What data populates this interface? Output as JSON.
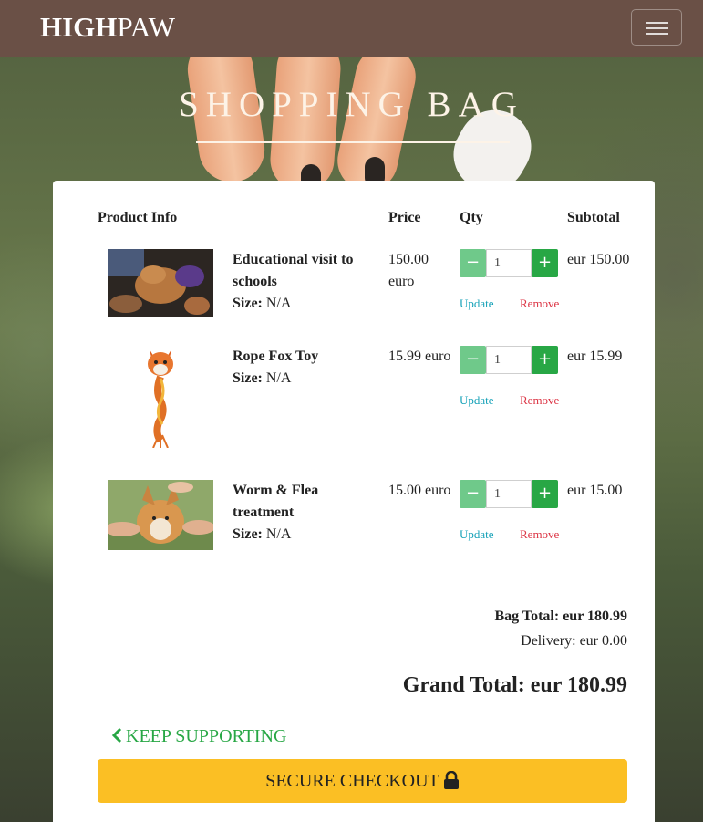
{
  "navbar": {
    "brand_bold": "HIGH",
    "brand_rest": "PAW"
  },
  "page": {
    "title": "SHOPPING BAG"
  },
  "table": {
    "headers": {
      "product": "Product Info",
      "price": "Price",
      "qty": "Qty",
      "subtotal": "Subtotal"
    },
    "items": [
      {
        "name": "Educational visit to schools",
        "size_label": "Size:",
        "size": "N/A",
        "price": "150.00 euro",
        "qty": "1",
        "subtotal": "eur 150.00",
        "update": "Update",
        "remove": "Remove"
      },
      {
        "name": "Rope Fox Toy",
        "size_label": "Size:",
        "size": "N/A",
        "price": "15.99 euro",
        "qty": "1",
        "subtotal": "eur 15.99",
        "update": "Update",
        "remove": "Remove"
      },
      {
        "name": "Worm & Flea treatment",
        "size_label": "Size:",
        "size": "N/A",
        "price": "15.00 euro",
        "qty": "1",
        "subtotal": "eur 15.00",
        "update": "Update",
        "remove": "Remove"
      }
    ]
  },
  "summary": {
    "bag_total": "Bag Total: eur 180.99",
    "delivery": "Delivery: eur 0.00",
    "grand_total": "Grand Total: eur 180.99"
  },
  "actions": {
    "keep_supporting": "KEEP SUPPORTING",
    "checkout": "SECURE CHECKOUT"
  },
  "icons": {
    "menu": "hamburger-icon",
    "back": "chevron-left-icon",
    "lock": "lock-icon",
    "minus": "minus-icon",
    "plus": "plus-icon"
  },
  "colors": {
    "navbar": "#6a5046",
    "green": "#28a745",
    "light_green": "#6fc98a",
    "update": "#17a2b8",
    "remove": "#dc3545",
    "checkout": "#fbbf24"
  }
}
